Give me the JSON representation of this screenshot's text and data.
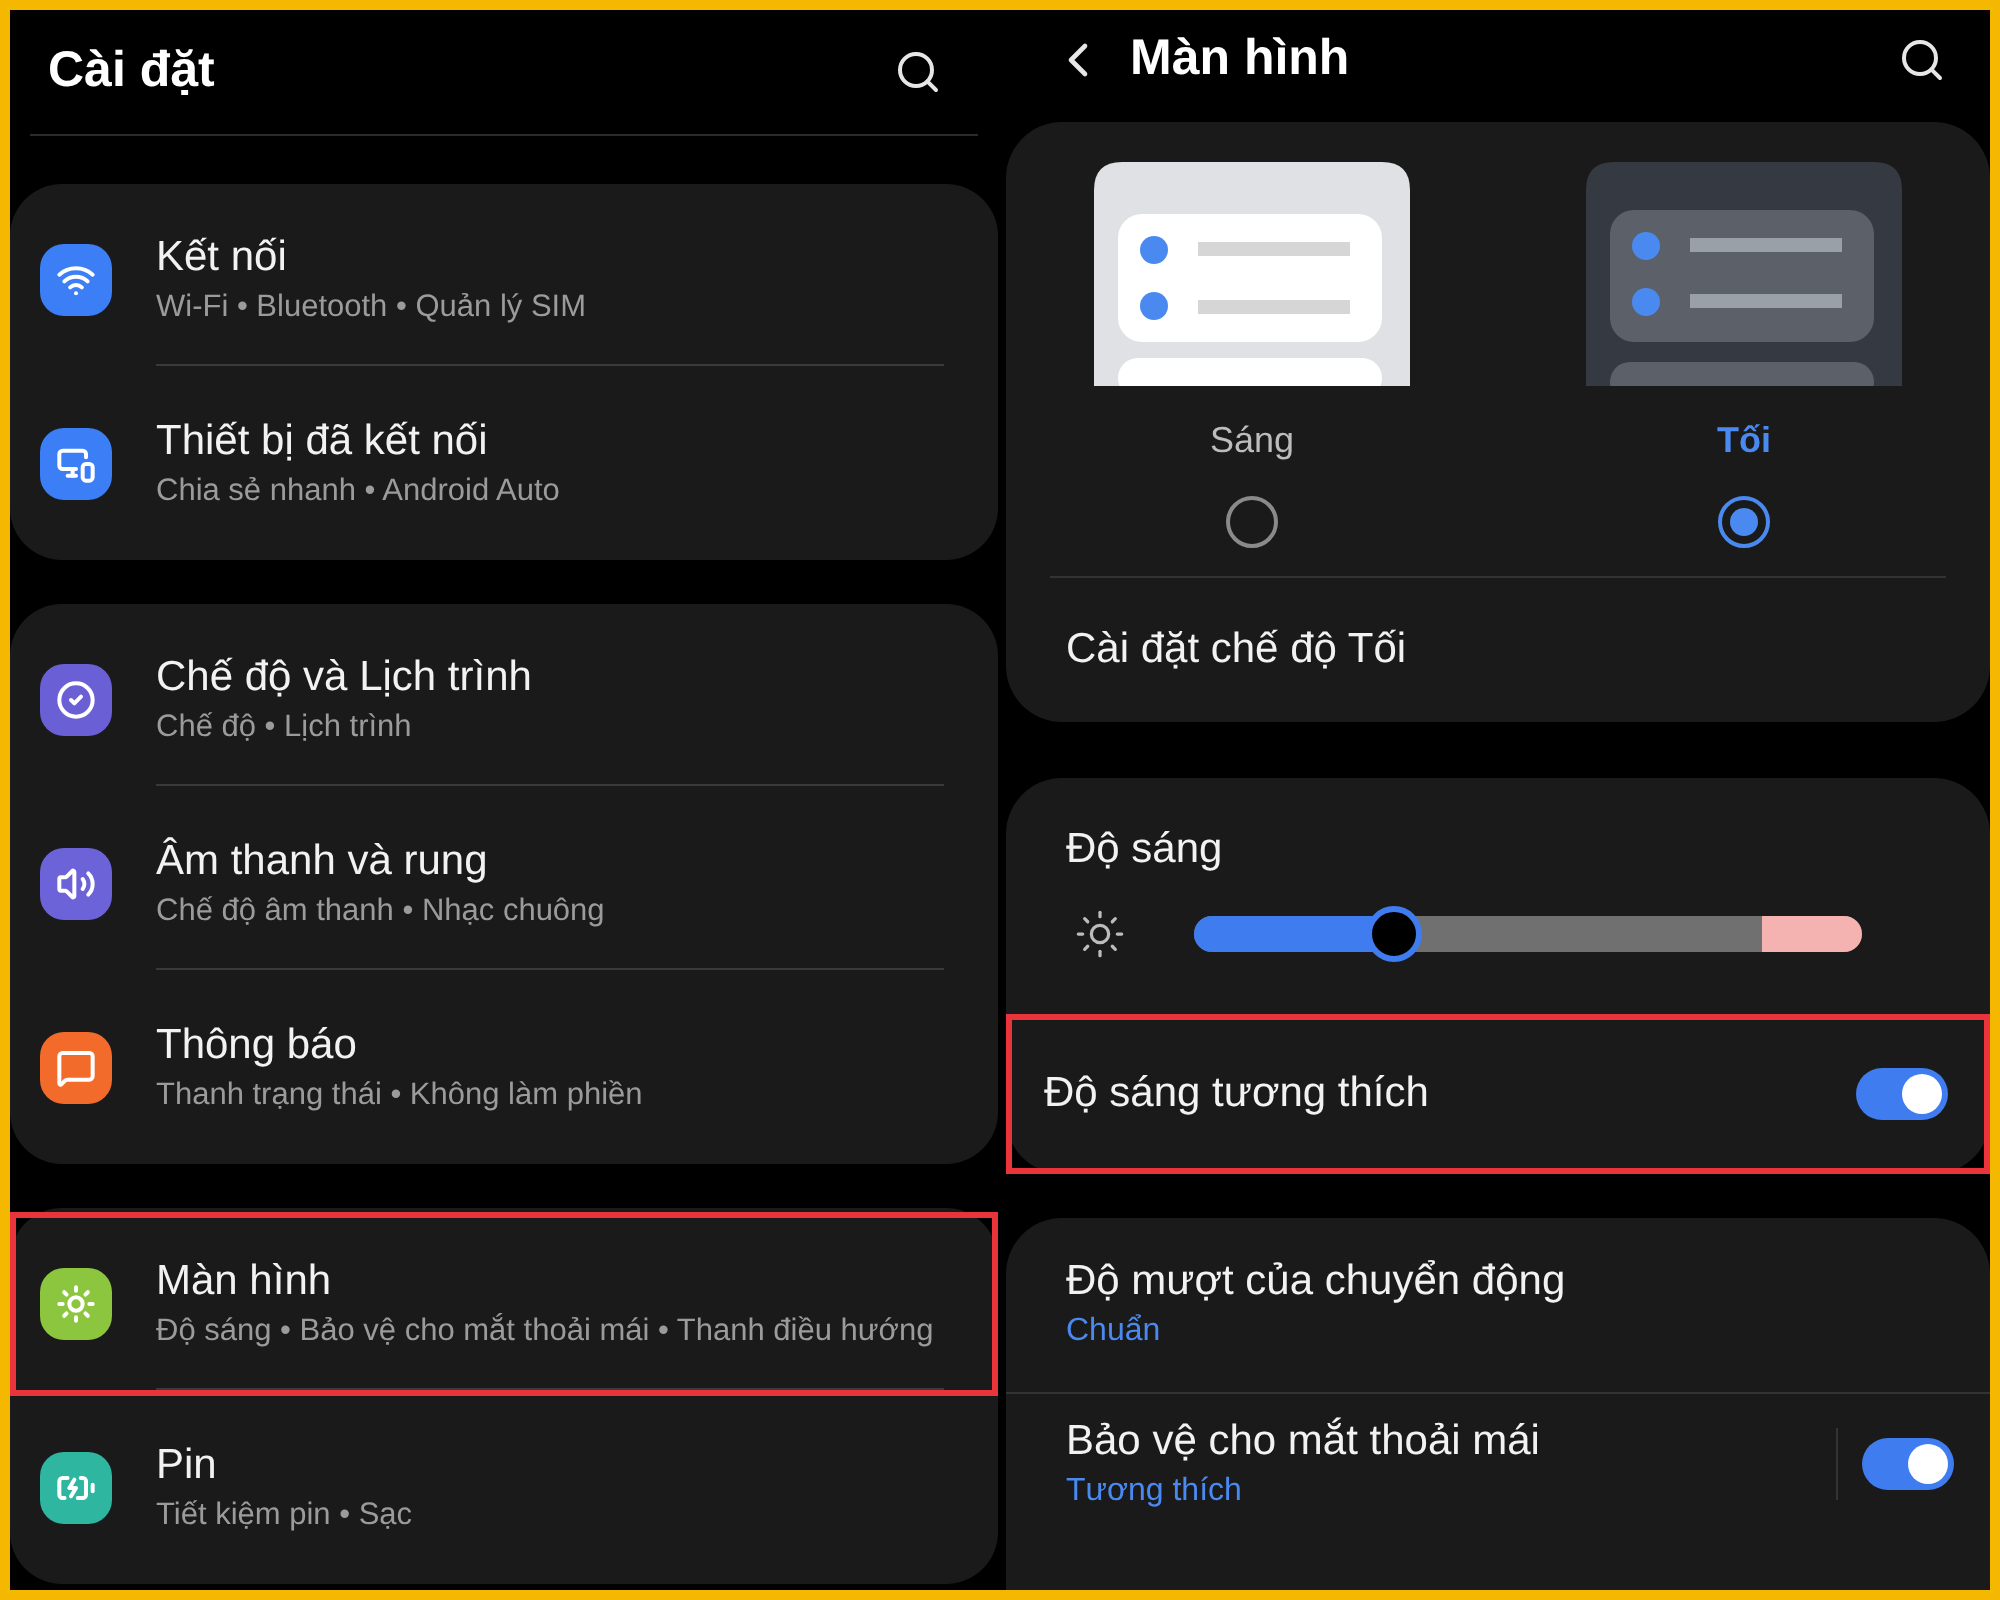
{
  "left": {
    "title": "Cài đặt",
    "groups": [
      [
        {
          "kind": "wifi",
          "color": "#3b7ef5",
          "title": "Kết nối",
          "subtitle": "Wi-Fi • Bluetooth • Quản lý SIM",
          "highlighted": false
        },
        {
          "kind": "devices",
          "color": "#3b7ef5",
          "title": "Thiết bị đã kết nối",
          "subtitle": "Chia sẻ nhanh • Android Auto",
          "highlighted": false
        }
      ],
      [
        {
          "kind": "modes",
          "color": "#6b5fd6",
          "title": "Chế độ và Lịch trình",
          "subtitle": "Chế độ • Lịch trình",
          "highlighted": false
        },
        {
          "kind": "sound",
          "color": "#6c63d9",
          "title": "Âm thanh và rung",
          "subtitle": "Chế độ âm thanh • Nhạc chuông",
          "highlighted": false
        },
        {
          "kind": "notifications",
          "color": "#f26b2a",
          "title": "Thông báo",
          "subtitle": "Thanh trạng thái • Không làm phiền",
          "highlighted": false
        }
      ],
      [
        {
          "kind": "display",
          "color": "#8cc63f",
          "title": "Màn hình",
          "subtitle": "Độ sáng • Bảo vệ cho mắt thoải mái • Thanh điều hướng",
          "highlighted": true
        },
        {
          "kind": "battery",
          "color": "#2eb6a0",
          "title": "Pin",
          "subtitle": "Tiết kiệm pin • Sạc",
          "highlighted": false
        }
      ]
    ]
  },
  "right": {
    "title": "Màn hình",
    "themes": [
      {
        "kind": "light",
        "label": "Sáng",
        "selected": false
      },
      {
        "kind": "dark",
        "label": "Tối",
        "selected": true
      }
    ],
    "dark_mode_settings": "Cài đặt chế độ Tối",
    "brightness": {
      "title": "Độ sáng",
      "level": 0.3
    },
    "adaptive": {
      "label": "Độ sáng tương thích",
      "on": true,
      "highlighted": true
    },
    "motion": {
      "title": "Độ mượt của chuyển động",
      "value": "Chuẩn"
    },
    "eye_comfort": {
      "title": "Bảo vệ cho mắt thoải mái",
      "value": "Tương thích",
      "on": true
    }
  }
}
